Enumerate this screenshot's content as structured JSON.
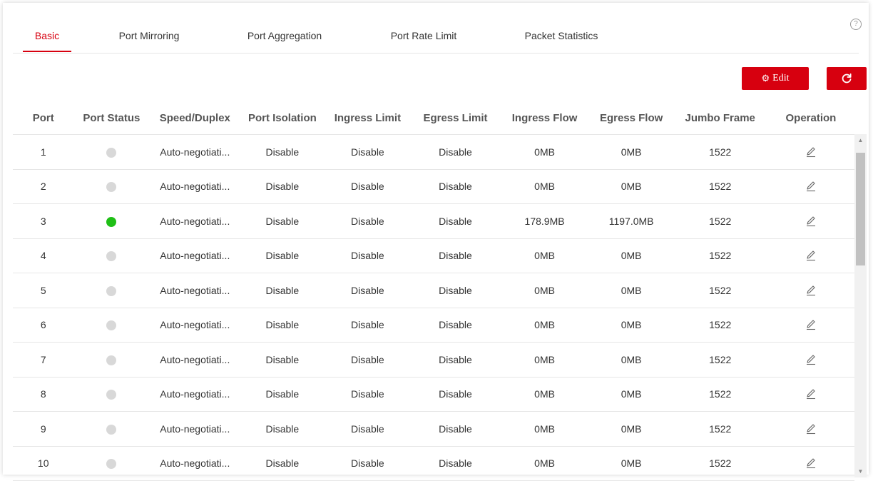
{
  "tabs": [
    {
      "label": "Basic",
      "active": true
    },
    {
      "label": "Port Mirroring",
      "active": false
    },
    {
      "label": "Port Aggregation",
      "active": false
    },
    {
      "label": "Port Rate Limit",
      "active": false
    },
    {
      "label": "Packet Statistics",
      "active": false
    }
  ],
  "help_icon": "help-circle-icon",
  "toolbar": {
    "edit_label": "Edit",
    "edit_icon": "gear-icon",
    "refresh_icon": "refresh-icon"
  },
  "colors": {
    "accent": "#d7000f",
    "status_up": "#1fbf16",
    "status_down": "#d8d8d8"
  },
  "table": {
    "headers": [
      "Port",
      "Port Status",
      "Speed/Duplex",
      "Port Isolation",
      "Ingress Limit",
      "Egress Limit",
      "Ingress Flow",
      "Egress Flow",
      "Jumbo Frame",
      "Operation"
    ],
    "rows": [
      {
        "port": "1",
        "status": "down",
        "speed": "Auto-negotiati...",
        "isolation": "Disable",
        "ingress_limit": "Disable",
        "egress_limit": "Disable",
        "ingress_flow": "0MB",
        "egress_flow": "0MB",
        "jumbo": "1522"
      },
      {
        "port": "2",
        "status": "down",
        "speed": "Auto-negotiati...",
        "isolation": "Disable",
        "ingress_limit": "Disable",
        "egress_limit": "Disable",
        "ingress_flow": "0MB",
        "egress_flow": "0MB",
        "jumbo": "1522"
      },
      {
        "port": "3",
        "status": "up",
        "speed": "Auto-negotiati...",
        "isolation": "Disable",
        "ingress_limit": "Disable",
        "egress_limit": "Disable",
        "ingress_flow": "178.9MB",
        "egress_flow": "1197.0MB",
        "jumbo": "1522"
      },
      {
        "port": "4",
        "status": "down",
        "speed": "Auto-negotiati...",
        "isolation": "Disable",
        "ingress_limit": "Disable",
        "egress_limit": "Disable",
        "ingress_flow": "0MB",
        "egress_flow": "0MB",
        "jumbo": "1522"
      },
      {
        "port": "5",
        "status": "down",
        "speed": "Auto-negotiati...",
        "isolation": "Disable",
        "ingress_limit": "Disable",
        "egress_limit": "Disable",
        "ingress_flow": "0MB",
        "egress_flow": "0MB",
        "jumbo": "1522"
      },
      {
        "port": "6",
        "status": "down",
        "speed": "Auto-negotiati...",
        "isolation": "Disable",
        "ingress_limit": "Disable",
        "egress_limit": "Disable",
        "ingress_flow": "0MB",
        "egress_flow": "0MB",
        "jumbo": "1522"
      },
      {
        "port": "7",
        "status": "down",
        "speed": "Auto-negotiati...",
        "isolation": "Disable",
        "ingress_limit": "Disable",
        "egress_limit": "Disable",
        "ingress_flow": "0MB",
        "egress_flow": "0MB",
        "jumbo": "1522"
      },
      {
        "port": "8",
        "status": "down",
        "speed": "Auto-negotiati...",
        "isolation": "Disable",
        "ingress_limit": "Disable",
        "egress_limit": "Disable",
        "ingress_flow": "0MB",
        "egress_flow": "0MB",
        "jumbo": "1522"
      },
      {
        "port": "9",
        "status": "down",
        "speed": "Auto-negotiati...",
        "isolation": "Disable",
        "ingress_limit": "Disable",
        "egress_limit": "Disable",
        "ingress_flow": "0MB",
        "egress_flow": "0MB",
        "jumbo": "1522"
      },
      {
        "port": "10",
        "status": "down",
        "speed": "Auto-negotiati...",
        "isolation": "Disable",
        "ingress_limit": "Disable",
        "egress_limit": "Disable",
        "ingress_flow": "0MB",
        "egress_flow": "0MB",
        "jumbo": "1522"
      }
    ],
    "operation_icon": "pencil-icon"
  }
}
